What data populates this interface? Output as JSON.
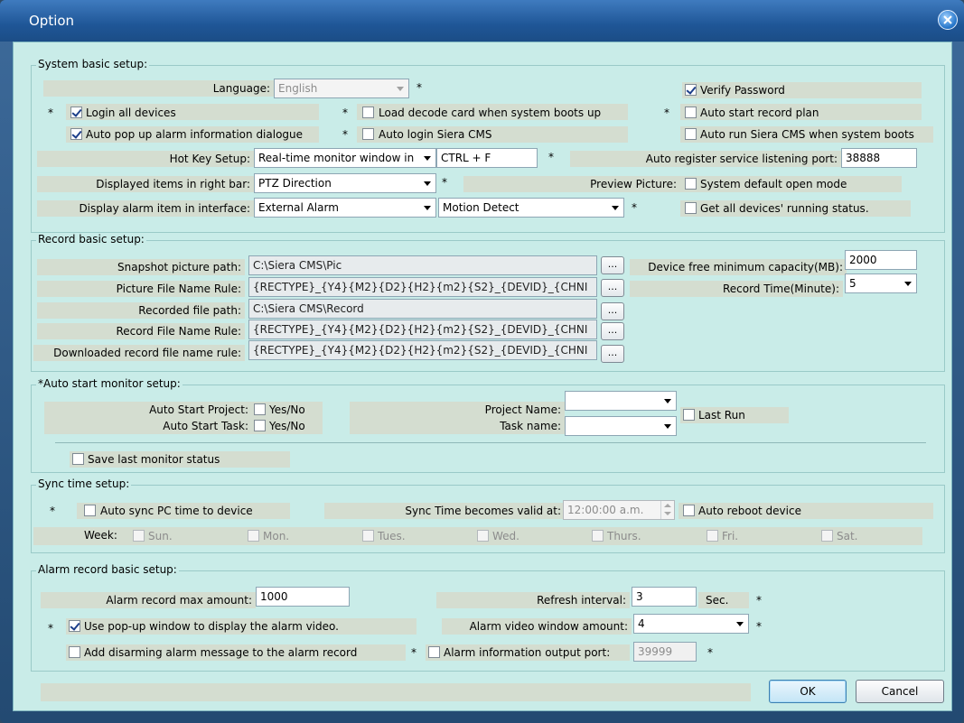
{
  "window": {
    "title": "Option",
    "close_icon": "close-icon"
  },
  "system": {
    "group_title": "System basic setup:",
    "language_label": "Language:",
    "language_value": "English",
    "verify_password": {
      "label": "Verify Password",
      "checked": true
    },
    "login_all": {
      "label": "Login all devices",
      "checked": true
    },
    "load_decode": {
      "label": "Load decode card when system boots up",
      "checked": false
    },
    "auto_start_record": {
      "label": "Auto start record plan",
      "checked": false
    },
    "auto_popup": {
      "label": "Auto pop up alarm information dialogue",
      "checked": true
    },
    "auto_login": {
      "label": "Auto login Siera CMS",
      "checked": false
    },
    "auto_run": {
      "label": "Auto run Siera CMS when system boots",
      "checked": false
    },
    "hotkey_label": "Hot Key Setup:",
    "hotkey_select": "Real-time monitor window in",
    "hotkey_value": "CTRL + F",
    "port_label": "Auto register service listening port:",
    "port_value": "38888",
    "right_bar_label": "Displayed items in right bar:",
    "right_bar_value": "PTZ Direction",
    "preview_label": "Preview Picture:",
    "preview_option": {
      "label": "System default open mode",
      "checked": false
    },
    "alarm_item_label": "Display alarm item in interface:",
    "alarm_item_value1": "External Alarm",
    "alarm_item_value2": "Motion Detect",
    "get_status": {
      "label": "Get all devices' running status.",
      "checked": false
    }
  },
  "record": {
    "group_title": "Record basic setup:",
    "snapshot_label": "Snapshot picture path:",
    "snapshot_value": "C:\\Siera CMS\\Pic",
    "picture_rule_label": "Picture File Name Rule:",
    "picture_rule_value": "{RECTYPE}_{Y4}{M2}{D2}{H2}{m2}{S2}_{DEVID}_{CHNI",
    "recorded_path_label": "Recorded file  path:",
    "recorded_path_value": "C:\\Siera CMS\\Record",
    "record_rule_label": "Record File Name Rule:",
    "record_rule_value": "{RECTYPE}_{Y4}{M2}{D2}{H2}{m2}{S2}_{DEVID}_{CHNI",
    "download_rule_label": "Downloaded record file name rule:",
    "download_rule_value": "{RECTYPE}_{Y4}{M2}{D2}{H2}{m2}{S2}_{DEVID}_{CHNI",
    "browse_label": "...",
    "min_capacity_label": "Device free minimum capacity(MB):",
    "min_capacity_value": "2000",
    "record_time_label": "Record Time(Minute):",
    "record_time_value": "5"
  },
  "monitor": {
    "group_title": "*Auto start monitor setup:",
    "start_project_label": "Auto Start Project:",
    "start_task_label": "Auto Start Task:",
    "yes_no_label": "Yes/No",
    "project_name_label": "Project Name:",
    "task_name_label": "Task name:",
    "last_run": {
      "label": "Last Run",
      "checked": false
    },
    "save_last": {
      "label": "Save last monitor status",
      "checked": false
    }
  },
  "sync": {
    "group_title": "Sync time setup:",
    "auto_sync": {
      "label": "Auto sync PC time to device",
      "checked": false
    },
    "valid_label": "Sync Time becomes valid at:",
    "valid_value": "12:00:00 a.m.",
    "auto_reboot": {
      "label": "Auto reboot device",
      "checked": false
    },
    "week_label": "Week:",
    "days": [
      "Sun.",
      "Mon.",
      "Tues.",
      "Wed.",
      "Thurs.",
      "Fri.",
      "Sat."
    ]
  },
  "alarm": {
    "group_title": "Alarm record basic setup:",
    "max_amount_label": "Alarm record max amount:",
    "max_amount_value": "1000",
    "refresh_label": "Refresh interval:",
    "refresh_value": "3",
    "refresh_unit": "Sec.",
    "use_popup": {
      "label": "Use pop-up window to display the alarm video.",
      "checked": true
    },
    "window_amount_label": "Alarm video window amount:",
    "window_amount_value": "4",
    "add_disarm": {
      "label": "Add disarming alarm message to the alarm record",
      "checked": false
    },
    "output_port": {
      "label": "Alarm information output port:",
      "checked": false
    },
    "output_port_value": "39999"
  },
  "footer": {
    "ok_label": "OK",
    "cancel_label": "Cancel"
  },
  "star": "*",
  "colors": {
    "titlebar": "#1f5697",
    "client": "#c9ece8",
    "label_shade": "#d4ddd0",
    "group_border": "#9acac8"
  }
}
